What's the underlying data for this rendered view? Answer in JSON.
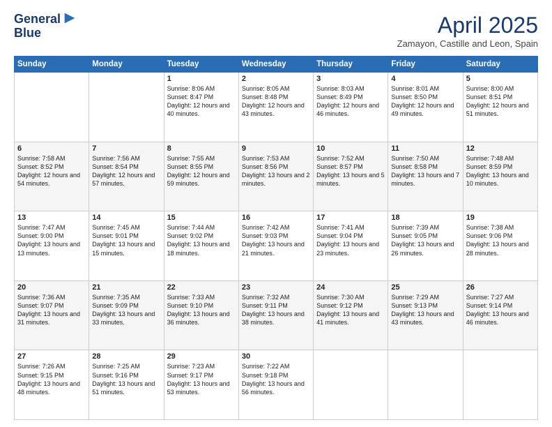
{
  "logo": {
    "line1": "General",
    "line2": "Blue"
  },
  "title": "April 2025",
  "subtitle": "Zamayon, Castille and Leon, Spain",
  "days_of_week": [
    "Sunday",
    "Monday",
    "Tuesday",
    "Wednesday",
    "Thursday",
    "Friday",
    "Saturday"
  ],
  "weeks": [
    [
      {
        "day": "",
        "sunrise": "",
        "sunset": "",
        "daylight": ""
      },
      {
        "day": "",
        "sunrise": "",
        "sunset": "",
        "daylight": ""
      },
      {
        "day": "1",
        "sunrise": "Sunrise: 8:06 AM",
        "sunset": "Sunset: 8:47 PM",
        "daylight": "Daylight: 12 hours and 40 minutes."
      },
      {
        "day": "2",
        "sunrise": "Sunrise: 8:05 AM",
        "sunset": "Sunset: 8:48 PM",
        "daylight": "Daylight: 12 hours and 43 minutes."
      },
      {
        "day": "3",
        "sunrise": "Sunrise: 8:03 AM",
        "sunset": "Sunset: 8:49 PM",
        "daylight": "Daylight: 12 hours and 46 minutes."
      },
      {
        "day": "4",
        "sunrise": "Sunrise: 8:01 AM",
        "sunset": "Sunset: 8:50 PM",
        "daylight": "Daylight: 12 hours and 49 minutes."
      },
      {
        "day": "5",
        "sunrise": "Sunrise: 8:00 AM",
        "sunset": "Sunset: 8:51 PM",
        "daylight": "Daylight: 12 hours and 51 minutes."
      }
    ],
    [
      {
        "day": "6",
        "sunrise": "Sunrise: 7:58 AM",
        "sunset": "Sunset: 8:52 PM",
        "daylight": "Daylight: 12 hours and 54 minutes."
      },
      {
        "day": "7",
        "sunrise": "Sunrise: 7:56 AM",
        "sunset": "Sunset: 8:54 PM",
        "daylight": "Daylight: 12 hours and 57 minutes."
      },
      {
        "day": "8",
        "sunrise": "Sunrise: 7:55 AM",
        "sunset": "Sunset: 8:55 PM",
        "daylight": "Daylight: 12 hours and 59 minutes."
      },
      {
        "day": "9",
        "sunrise": "Sunrise: 7:53 AM",
        "sunset": "Sunset: 8:56 PM",
        "daylight": "Daylight: 13 hours and 2 minutes."
      },
      {
        "day": "10",
        "sunrise": "Sunrise: 7:52 AM",
        "sunset": "Sunset: 8:57 PM",
        "daylight": "Daylight: 13 hours and 5 minutes."
      },
      {
        "day": "11",
        "sunrise": "Sunrise: 7:50 AM",
        "sunset": "Sunset: 8:58 PM",
        "daylight": "Daylight: 13 hours and 7 minutes."
      },
      {
        "day": "12",
        "sunrise": "Sunrise: 7:48 AM",
        "sunset": "Sunset: 8:59 PM",
        "daylight": "Daylight: 13 hours and 10 minutes."
      }
    ],
    [
      {
        "day": "13",
        "sunrise": "Sunrise: 7:47 AM",
        "sunset": "Sunset: 9:00 PM",
        "daylight": "Daylight: 13 hours and 13 minutes."
      },
      {
        "day": "14",
        "sunrise": "Sunrise: 7:45 AM",
        "sunset": "Sunset: 9:01 PM",
        "daylight": "Daylight: 13 hours and 15 minutes."
      },
      {
        "day": "15",
        "sunrise": "Sunrise: 7:44 AM",
        "sunset": "Sunset: 9:02 PM",
        "daylight": "Daylight: 13 hours and 18 minutes."
      },
      {
        "day": "16",
        "sunrise": "Sunrise: 7:42 AM",
        "sunset": "Sunset: 9:03 PM",
        "daylight": "Daylight: 13 hours and 21 minutes."
      },
      {
        "day": "17",
        "sunrise": "Sunrise: 7:41 AM",
        "sunset": "Sunset: 9:04 PM",
        "daylight": "Daylight: 13 hours and 23 minutes."
      },
      {
        "day": "18",
        "sunrise": "Sunrise: 7:39 AM",
        "sunset": "Sunset: 9:05 PM",
        "daylight": "Daylight: 13 hours and 26 minutes."
      },
      {
        "day": "19",
        "sunrise": "Sunrise: 7:38 AM",
        "sunset": "Sunset: 9:06 PM",
        "daylight": "Daylight: 13 hours and 28 minutes."
      }
    ],
    [
      {
        "day": "20",
        "sunrise": "Sunrise: 7:36 AM",
        "sunset": "Sunset: 9:07 PM",
        "daylight": "Daylight: 13 hours and 31 minutes."
      },
      {
        "day": "21",
        "sunrise": "Sunrise: 7:35 AM",
        "sunset": "Sunset: 9:09 PM",
        "daylight": "Daylight: 13 hours and 33 minutes."
      },
      {
        "day": "22",
        "sunrise": "Sunrise: 7:33 AM",
        "sunset": "Sunset: 9:10 PM",
        "daylight": "Daylight: 13 hours and 36 minutes."
      },
      {
        "day": "23",
        "sunrise": "Sunrise: 7:32 AM",
        "sunset": "Sunset: 9:11 PM",
        "daylight": "Daylight: 13 hours and 38 minutes."
      },
      {
        "day": "24",
        "sunrise": "Sunrise: 7:30 AM",
        "sunset": "Sunset: 9:12 PM",
        "daylight": "Daylight: 13 hours and 41 minutes."
      },
      {
        "day": "25",
        "sunrise": "Sunrise: 7:29 AM",
        "sunset": "Sunset: 9:13 PM",
        "daylight": "Daylight: 13 hours and 43 minutes."
      },
      {
        "day": "26",
        "sunrise": "Sunrise: 7:27 AM",
        "sunset": "Sunset: 9:14 PM",
        "daylight": "Daylight: 13 hours and 46 minutes."
      }
    ],
    [
      {
        "day": "27",
        "sunrise": "Sunrise: 7:26 AM",
        "sunset": "Sunset: 9:15 PM",
        "daylight": "Daylight: 13 hours and 48 minutes."
      },
      {
        "day": "28",
        "sunrise": "Sunrise: 7:25 AM",
        "sunset": "Sunset: 9:16 PM",
        "daylight": "Daylight: 13 hours and 51 minutes."
      },
      {
        "day": "29",
        "sunrise": "Sunrise: 7:23 AM",
        "sunset": "Sunset: 9:17 PM",
        "daylight": "Daylight: 13 hours and 53 minutes."
      },
      {
        "day": "30",
        "sunrise": "Sunrise: 7:22 AM",
        "sunset": "Sunset: 9:18 PM",
        "daylight": "Daylight: 13 hours and 56 minutes."
      },
      {
        "day": "",
        "sunrise": "",
        "sunset": "",
        "daylight": ""
      },
      {
        "day": "",
        "sunrise": "",
        "sunset": "",
        "daylight": ""
      },
      {
        "day": "",
        "sunrise": "",
        "sunset": "",
        "daylight": ""
      }
    ]
  ]
}
